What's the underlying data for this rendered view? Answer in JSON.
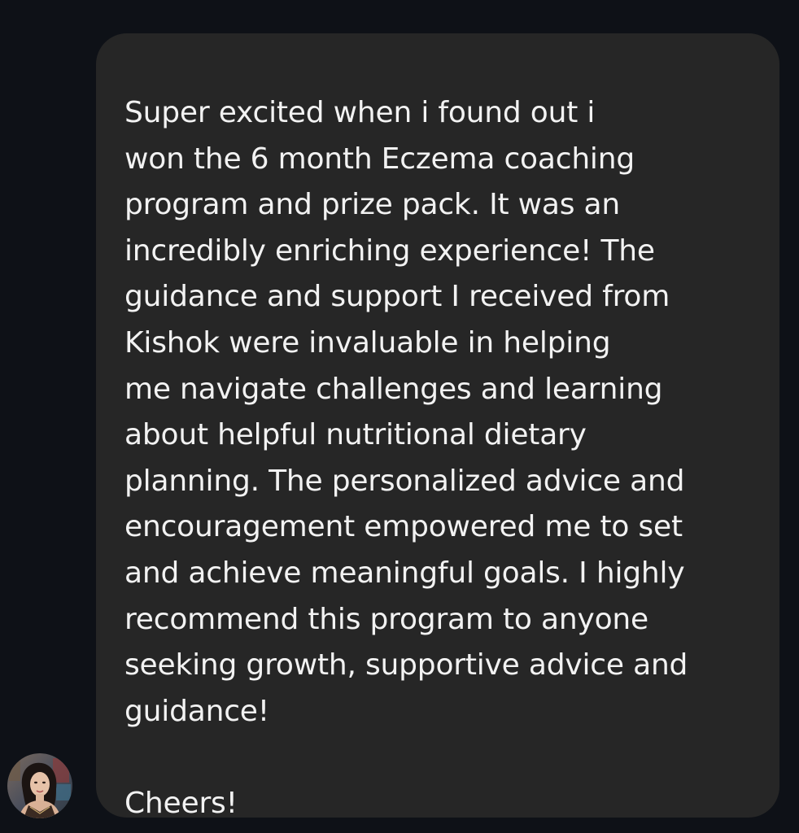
{
  "message": {
    "lines": [
      "Super excited when i found out i",
      "won the 6 month Eczema coaching",
      "program and prize pack. It was an",
      "incredibly enriching experience! The",
      "guidance and support I received from",
      "Kishok were invaluable in helping",
      "me navigate challenges and learning",
      "about helpful nutritional dietary",
      "planning. The personalized advice and",
      "encouragement empowered me to set",
      "and achieve meaningful goals. I highly",
      "recommend this program to anyone",
      "seeking growth, supportive advice and",
      "guidance!"
    ],
    "signoff": "Cheers!"
  },
  "sender": {
    "avatar_icon": "user-avatar-photo"
  },
  "colors": {
    "background": "#0e1117",
    "bubble": "#262626",
    "text": "#f2f2f2"
  }
}
